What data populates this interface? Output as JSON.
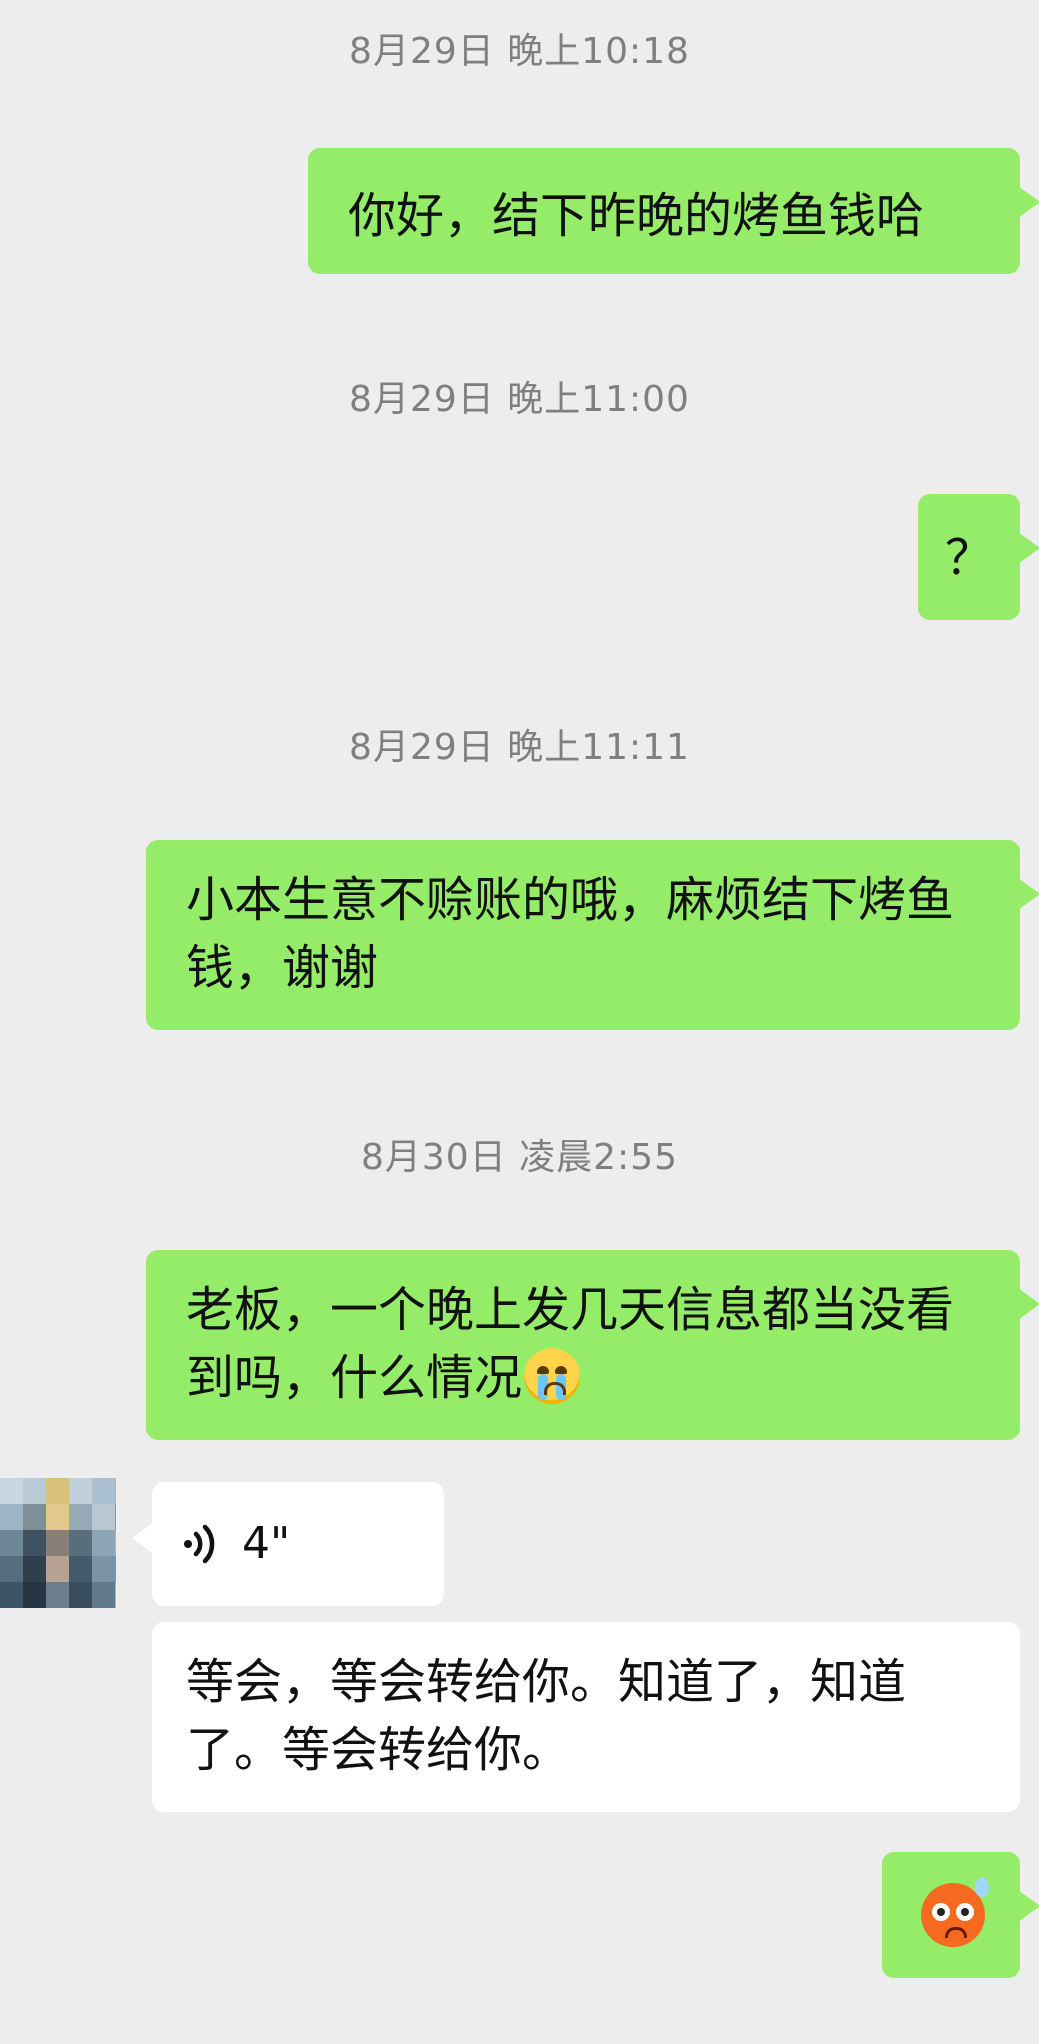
{
  "timestamps": [
    "8月29日 晚上10:18",
    "8月29日 晚上11:00",
    "8月29日 晚上11:11",
    "8月30日 凌晨2:55"
  ],
  "messages": [
    {
      "from": "me",
      "text": "你好，结下昨晚的烤鱼钱哈"
    },
    {
      "from": "me",
      "text": "？"
    },
    {
      "from": "me",
      "text": "小本生意不赊账的哦，麻烦结下烤鱼钱，谢谢"
    },
    {
      "from": "me",
      "text": "老板，一个晚上发几天信息都当没看到吗，什么情况",
      "emoji": "crying-face-emoji"
    },
    {
      "from": "other",
      "type": "voice",
      "duration": "4\"",
      "transcript": "等会，等会转给你。知道了，知道了。等会转给你。"
    },
    {
      "from": "me",
      "emoji": "anxious-sweat-face-emoji"
    }
  ],
  "colors": {
    "background": "#ededed",
    "outgoing_bubble": "#95ec69",
    "incoming_bubble": "#ffffff",
    "timestamp_text": "#7f7f7f"
  },
  "icons": {
    "voice": "voice-wave-icon"
  }
}
